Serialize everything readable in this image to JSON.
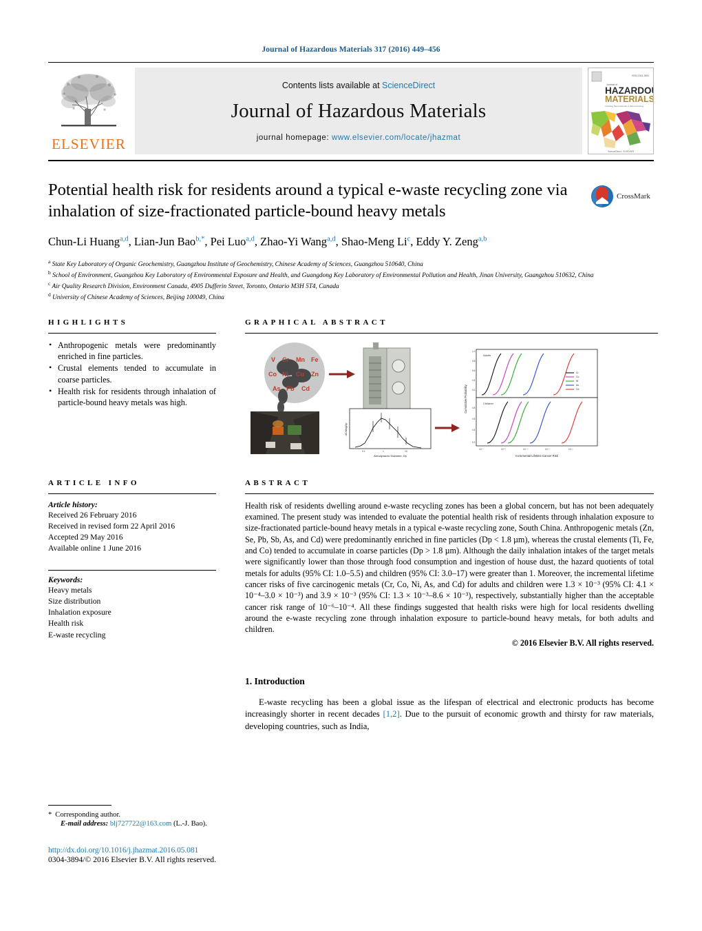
{
  "running_head": "Journal of Hazardous Materials 317 (2016) 449–456",
  "masthead": {
    "contents_prefix": "Contents lists available at ",
    "sciencedirect": "ScienceDirect",
    "journal_title": "Journal of Hazardous Materials",
    "homepage_prefix": "journal homepage: ",
    "homepage_url": "www.elsevier.com/locate/jhazmat",
    "publisher": "ELSEVIER",
    "cover_title_1": "HAZARDOUS",
    "cover_title_2": "MATERIALS",
    "accent_orange": "#E9711C",
    "link_blue": "#1a7ab5"
  },
  "article": {
    "title": "Potential health risk for residents around a typical e-waste recycling zone via inhalation of size-fractionated particle-bound heavy metals",
    "crossmark_label": "CrossMark",
    "authors": [
      {
        "name": "Chun-Li Huang",
        "sup": "a,d",
        "sep": ", "
      },
      {
        "name": "Lian-Jun Bao",
        "sup": "b,*",
        "sep": ", "
      },
      {
        "name": "Pei Luo",
        "sup": "a,d",
        "sep": ", "
      },
      {
        "name": "Zhao-Yi Wang",
        "sup": "a,d",
        "sep": ", "
      },
      {
        "name": "Shao-Meng Li",
        "sup": "c",
        "sep": ", "
      },
      {
        "name": "Eddy Y. Zeng",
        "sup": "a,b",
        "sep": ""
      }
    ],
    "affiliations": [
      {
        "mark": "a",
        "text": "State Key Laboratory of Organic Geochemistry, Guangzhou Institute of Geochemistry, Chinese Academy of Sciences, Guangzhou 510640, China"
      },
      {
        "mark": "b",
        "text": "School of Environment, Guangzhou Key Laboratory of Environmental Exposure and Health, and Guangdong Key Laboratory of Environmental Pollution and Health, Jinan University, Guangzhou 510632, China"
      },
      {
        "mark": "c",
        "text": "Air Quality Research Division, Environment Canada, 4905 Dufferin Street, Toronto, Ontario M3H 5T4, Canada"
      },
      {
        "mark": "d",
        "text": "University of Chinese Academy of Sciences, Beijing 100049, China"
      }
    ]
  },
  "highlights": {
    "heading": "HIGHLIGHTS",
    "items": [
      "Anthropogenic metals were predominantly enriched in fine particles.",
      "Crustal elements tended to accumulate in coarse particles.",
      "Health risk for residents through inhalation of particle-bound heavy metals was high."
    ]
  },
  "graphical_abstract": {
    "heading": "GRAPHICAL ABSTRACT",
    "elements_row1": [
      "V",
      "Cr",
      "Mn",
      "Fe"
    ],
    "elements_row2": [
      "Co",
      "Ni",
      "Cu",
      "Zn"
    ],
    "elements_row3": [
      "As",
      "Pb",
      "Cd"
    ],
    "chart1_xlabel": "Aerodynamic Diameter, Dp",
    "chart1_ylabel": "dC/dlogDp",
    "chart2_xlabel": "Incremental Lifetime Cancer Risk",
    "chart2_ylabel": "Cumulative Probability",
    "chart2_panel1": "Adults",
    "chart2_panel2": "Children",
    "legend": [
      "Cr",
      "Co",
      "Ni",
      "As",
      "Cd"
    ]
  },
  "article_info": {
    "heading": "ARTICLE INFO",
    "history_label": "Article history:",
    "history": [
      "Received 26 February 2016",
      "Received in revised form 22 April 2016",
      "Accepted 29 May 2016",
      "Available online 1 June 2016"
    ],
    "keywords_label": "Keywords:",
    "keywords": [
      "Heavy metals",
      "Size distribution",
      "Inhalation exposure",
      "Health risk",
      "E-waste recycling"
    ]
  },
  "abstract": {
    "heading": "ABSTRACT",
    "body": "Health risk of residents dwelling around e-waste recycling zones has been a global concern, but has not been adequately examined. The present study was intended to evaluate the potential health risk of residents through inhalation exposure to size-fractionated particle-bound heavy metals in a typical e-waste recycling zone, South China. Anthropogenic metals (Zn, Se, Pb, Sb, As, and Cd) were predominantly enriched in fine particles (Dp < 1.8 µm), whereas the crustal elements (Ti, Fe, and Co) tended to accumulate in coarse particles (Dp > 1.8 µm). Although the daily inhalation intakes of the target metals were significantly lower than those through food consumption and ingestion of house dust, the hazard quotients of total metals for adults (95% CI: 1.0–5.5) and children (95% CI: 3.0–17) were greater than 1. Moreover, the incremental lifetime cancer risks of five carcinogenic metals (Cr, Co, Ni, As, and Cd) for adults and children were 1.3 × 10⁻³ (95% CI: 4.1 × 10⁻⁴–3.0 × 10⁻³) and 3.9 × 10⁻³ (95% CI: 1.3 × 10⁻³–8.6 × 10⁻³), respectively, substantially higher than the acceptable cancer risk range of 10⁻⁶–10⁻⁴. All these findings suggested that health risks were high for local residents dwelling around the e-waste recycling zone through inhalation exposure to particle-bound heavy metals, for both adults and children.",
    "copyright": "© 2016 Elsevier B.V. All rights reserved."
  },
  "introduction": {
    "heading": "1.  Introduction",
    "paragraph_part1": "E-waste recycling has been a global issue as the lifespan of electrical and electronic products has become increasingly shorter in recent decades ",
    "citation": "[1,2]",
    "paragraph_part2": ". Due to the pursuit of economic growth and thirsty for raw materials, developing countries, such as India,"
  },
  "footnote": {
    "corresponding": "Corresponding author.",
    "email_label": "E-mail address:",
    "email": "blj727722@163.com",
    "email_owner": "(L.-J. Bao)."
  },
  "footer": {
    "doi": "http://dx.doi.org/10.1016/j.jhazmat.2016.05.081",
    "issn_line": "0304-3894/© 2016 Elsevier B.V. All rights reserved."
  }
}
